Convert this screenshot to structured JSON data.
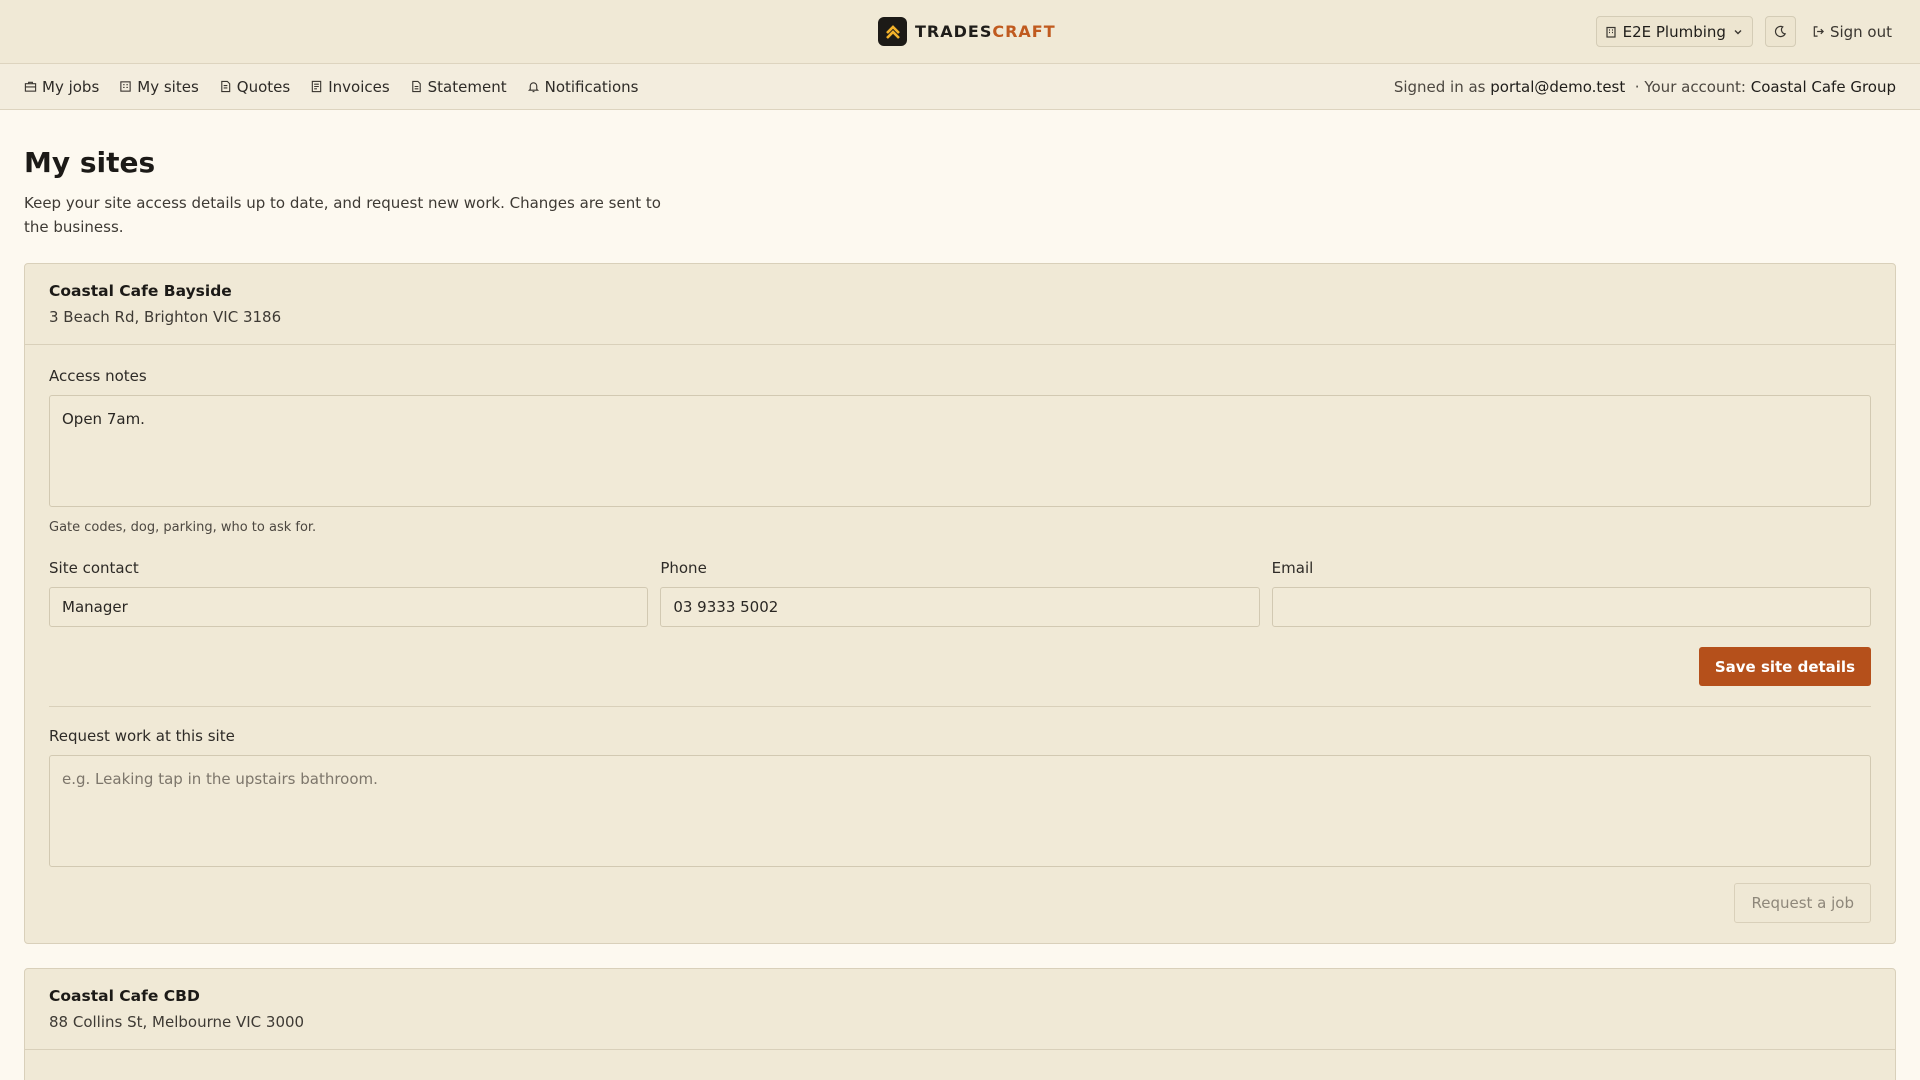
{
  "brand": {
    "part1": "TRADES",
    "part2": "CRAFT",
    "logo_icon": "chevron-up-icon",
    "accent": "#c05a1f"
  },
  "header": {
    "business_select": "E2E Plumbing",
    "theme_icon": "moon-icon",
    "sign_out": "Sign out"
  },
  "nav": {
    "items": [
      {
        "label": "My jobs",
        "icon": "briefcase-icon"
      },
      {
        "label": "My sites",
        "icon": "building-icon"
      },
      {
        "label": "Quotes",
        "icon": "quote-icon"
      },
      {
        "label": "Invoices",
        "icon": "invoice-icon"
      },
      {
        "label": "Statement",
        "icon": "document-icon"
      },
      {
        "label": "Notifications",
        "icon": "bell-icon"
      }
    ],
    "signed_in_prefix": "Signed in as",
    "email": "portal@demo.test",
    "account_prefix": "· Your account:",
    "account": "Coastal Cafe Group"
  },
  "page": {
    "title": "My sites",
    "description": "Keep your site access details up to date, and request new work. Changes are sent to the business."
  },
  "sites": [
    {
      "name": "Coastal Cafe Bayside",
      "address": "3 Beach Rd, Brighton VIC 3186",
      "access_notes_label": "Access notes",
      "access_notes": "Open 7am.",
      "access_hint": "Gate codes, dog, parking, who to ask for.",
      "contact_label": "Site contact",
      "contact": "Manager",
      "phone_label": "Phone",
      "phone": "03 9333 5002",
      "email_label": "Email",
      "email": "",
      "save_label": "Save site details",
      "request_label": "Request work at this site",
      "request_placeholder": "e.g. Leaking tap in the upstairs bathroom.",
      "request_button": "Request a job"
    },
    {
      "name": "Coastal Cafe CBD",
      "address": "88 Collins St, Melbourne VIC 3000"
    }
  ]
}
